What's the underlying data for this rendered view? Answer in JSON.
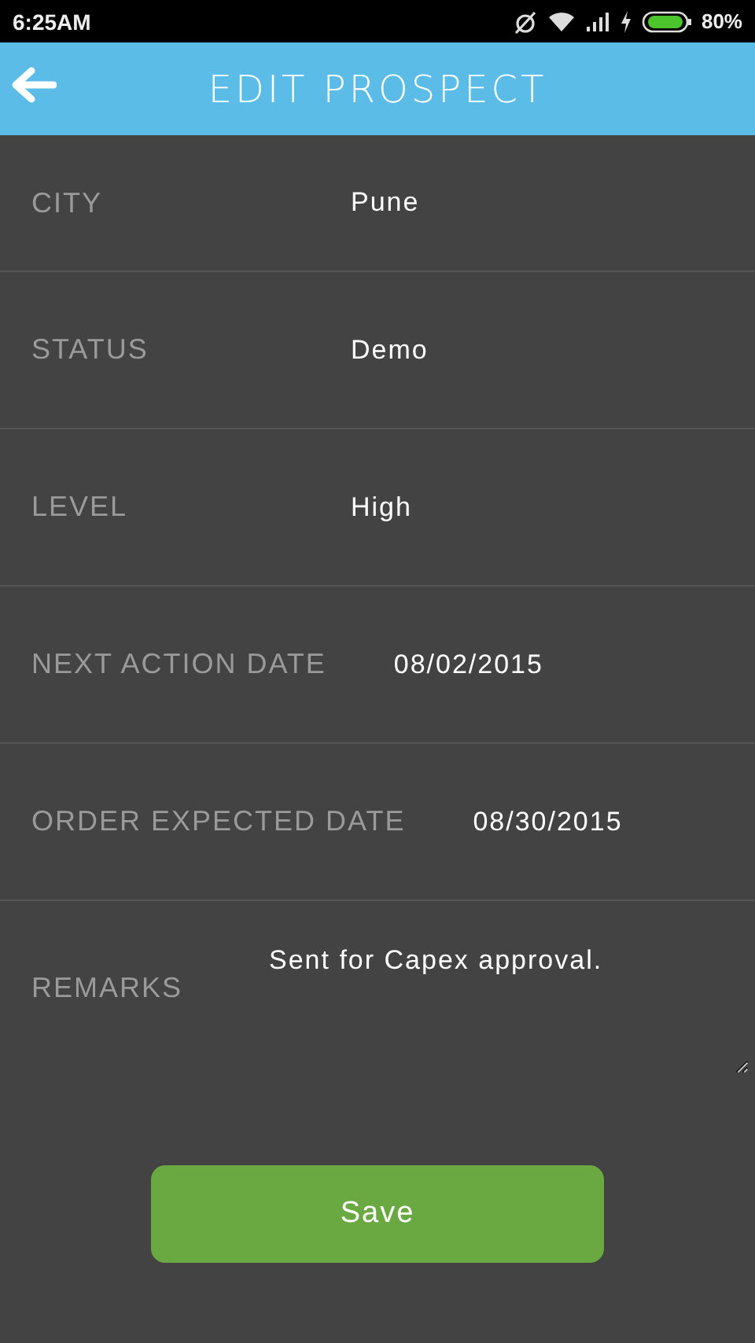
{
  "status_bar": {
    "time": "6:25AM",
    "battery": "80%"
  },
  "app_bar": {
    "title": "EDIT PROSPECT"
  },
  "fields": [
    {
      "kind": "text",
      "label": "CITY",
      "value": "Pune"
    },
    {
      "kind": "text",
      "label": "STATUS",
      "value": "Demo"
    },
    {
      "kind": "text",
      "label": "LEVEL",
      "value": "High"
    },
    {
      "kind": "text",
      "label": "NEXT ACTION DATE",
      "value": "08/02/2015"
    },
    {
      "kind": "text",
      "label": "ORDER EXPECTED DATE",
      "value": "08/30/2015"
    },
    {
      "kind": "textarea",
      "label": "REMARKS",
      "value": "Sent for Capex approval."
    }
  ],
  "save_button": "Save"
}
